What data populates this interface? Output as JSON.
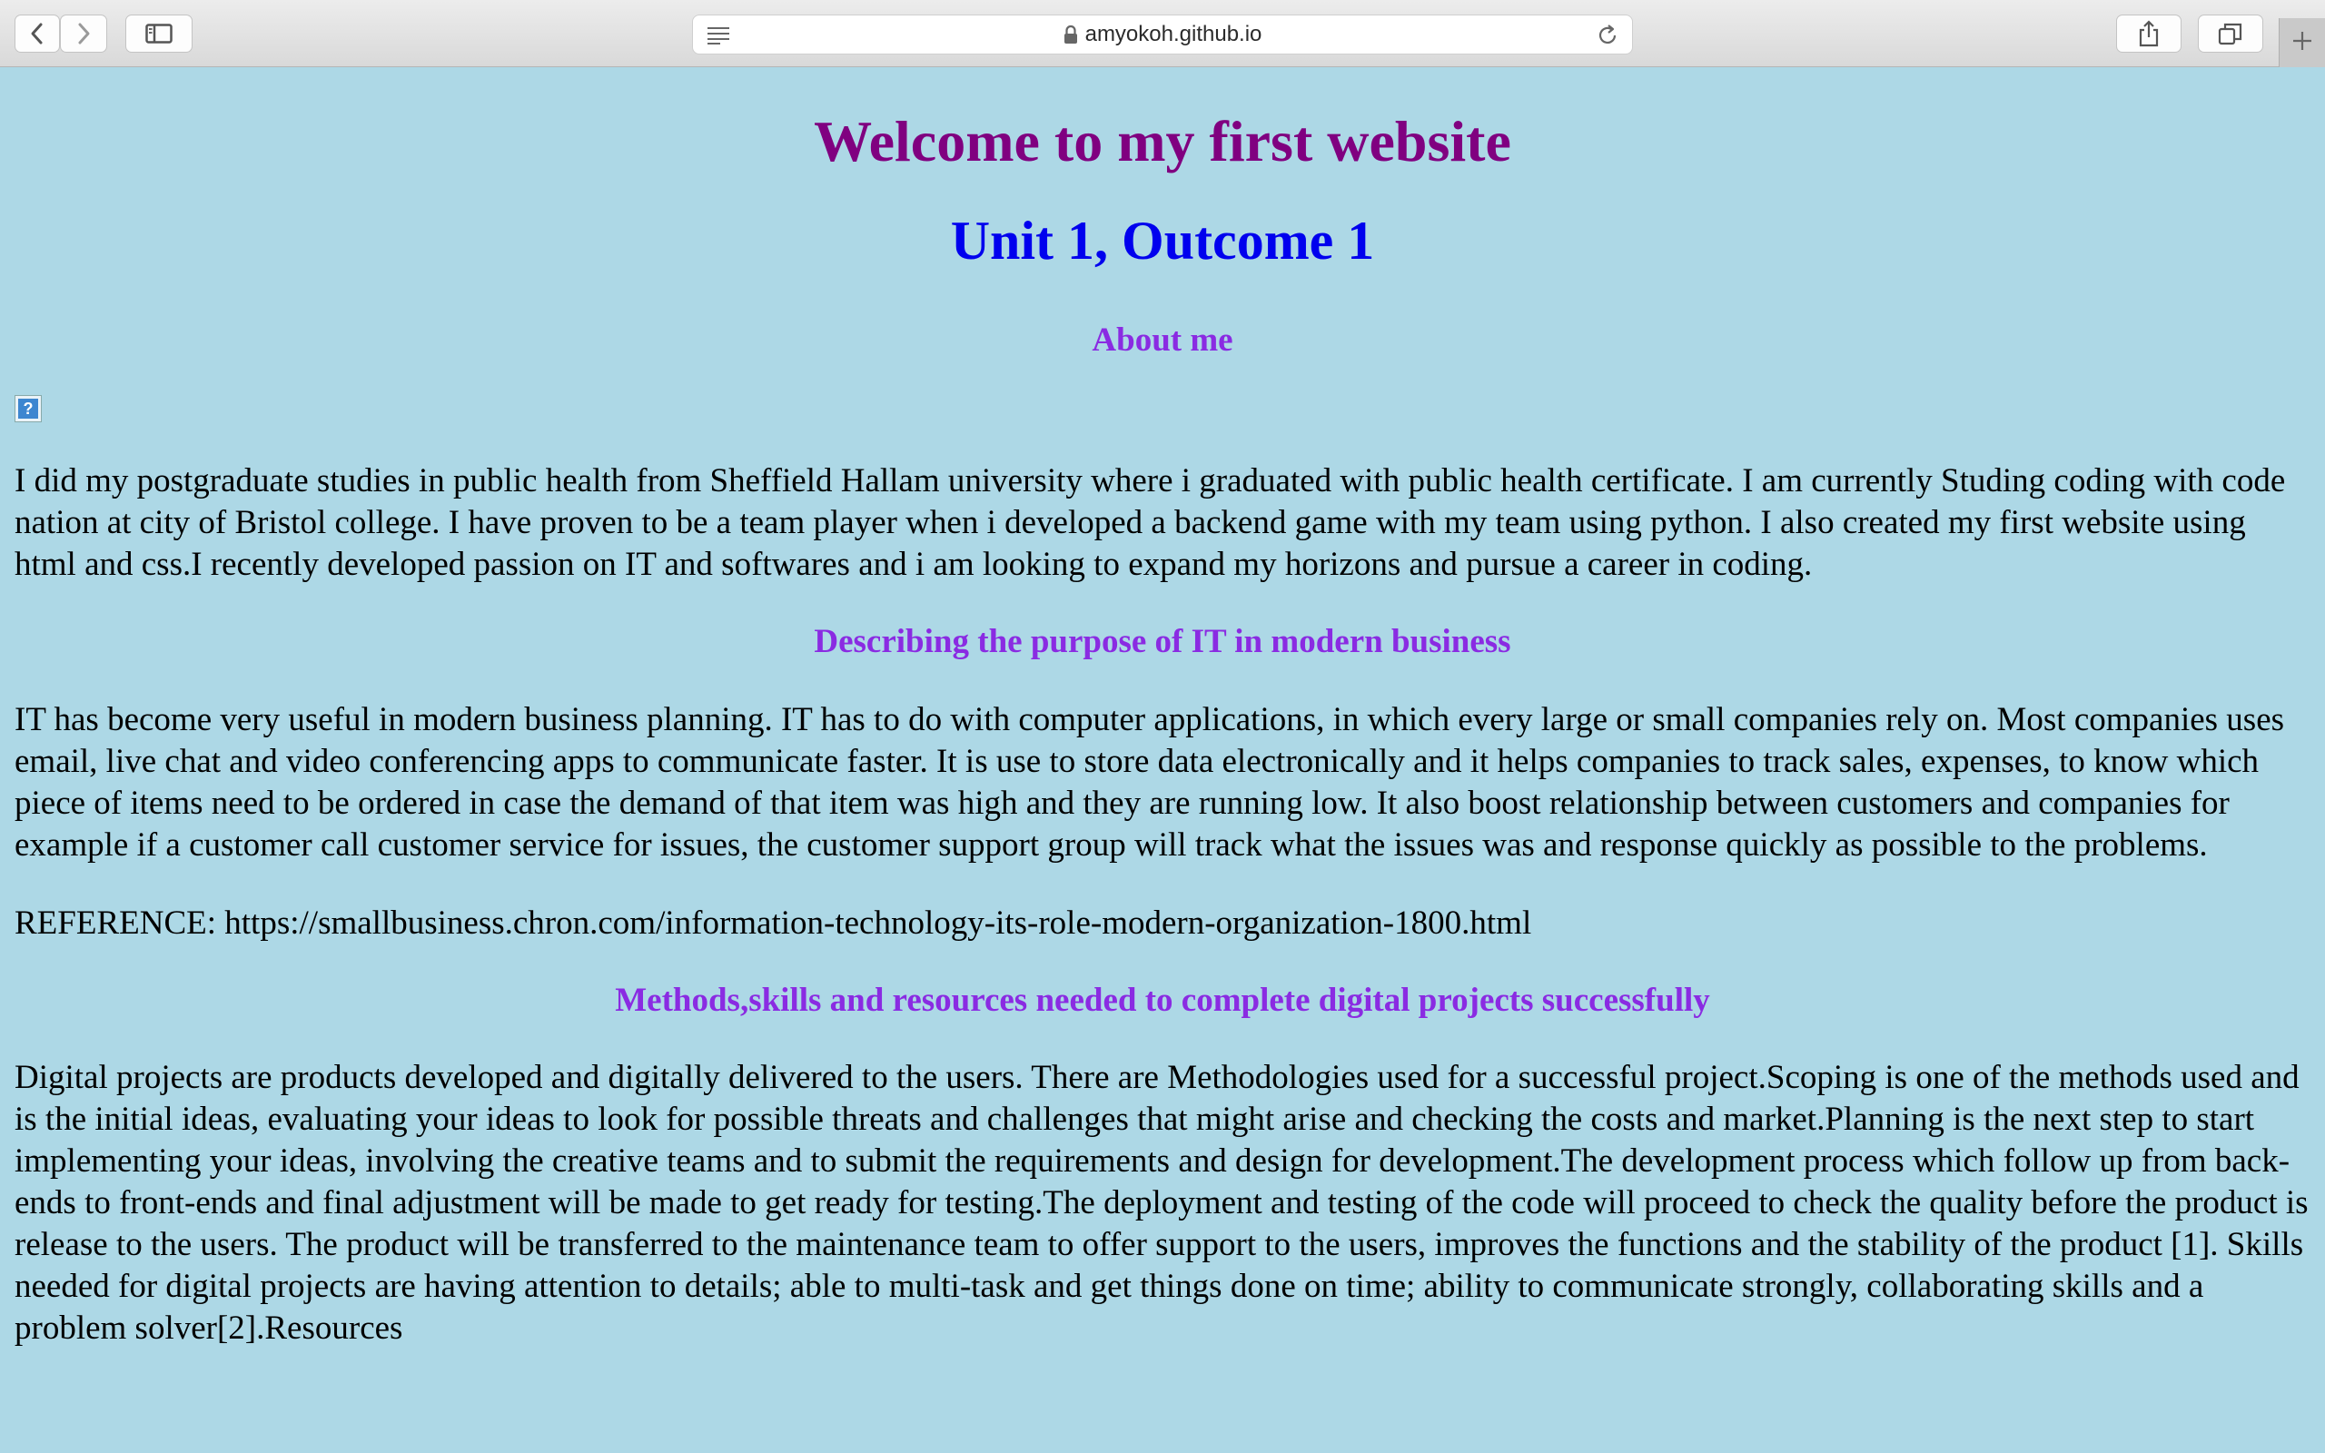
{
  "browser": {
    "url": "amyokoh.github.io",
    "icons": {
      "back": "chevron-left-icon",
      "forward": "chevron-right-icon",
      "sidebar": "sidebar-icon",
      "reader": "reader-icon",
      "lock": "lock-icon",
      "reload": "reload-icon",
      "share": "share-icon",
      "tabs": "tabs-overview-icon",
      "new_tab": "plus-icon"
    }
  },
  "page": {
    "background_color": "#add8e6",
    "title": "Welcome to my first website",
    "subtitle": "Unit 1, Outcome 1",
    "about_heading": "About me",
    "about_image_placeholder": "?",
    "about_text": "I did my postgraduate studies in public health from Sheffield Hallam university where i graduated with public health certificate. I am currently Studing coding with code nation at city of Bristol college. I have proven to be a team player when i developed a backend game with my team using python. I also created my first website using html and css.I recently developed passion on IT and softwares and i am looking to expand my horizons and pursue a career in coding.",
    "it_heading": "Describing the purpose of IT in modern business",
    "it_text": "IT has become very useful in modern business planning. IT has to do with computer applications, in which every large or small companies rely on. Most companies uses email, live chat and video conferencing apps to communicate faster. It is use to store data electronically and it helps companies to track sales, expenses, to know which piece of items need to be ordered in case the demand of that item was high and they are running low. It also boost relationship between customers and companies for example if a customer call customer service for issues, the customer support group will track what the issues was and response quickly as possible to the problems.",
    "reference": "REFERENCE: https://smallbusiness.chron.com/information-technology-its-role-modern-organization-1800.html",
    "methods_heading": "Methods,skills and resources needed to complete digital projects successfully",
    "methods_text": "Digital projects are products developed and digitally delivered to the users. There are Methodologies used for a successful project.Scoping is one of the methods used and is the initial ideas, evaluating your ideas to look for possible threats and challenges that might arise and checking the costs and market.Planning is the next step to start implementing your ideas, involving the creative teams and to submit the requirements and design for development.The development process which follow up from back-ends to front-ends and final adjustment will be made to get ready for testing.The deployment and testing of the code will proceed to check the quality before the product is release to the users. The product will be transferred to the maintenance team to offer support to the users, improves the functions and the stability of the product [1]. Skills needed for digital projects are having attention to details; able to multi-task and get things done on time; ability to communicate strongly, collaborating skills and a problem solver[2].Resources"
  }
}
